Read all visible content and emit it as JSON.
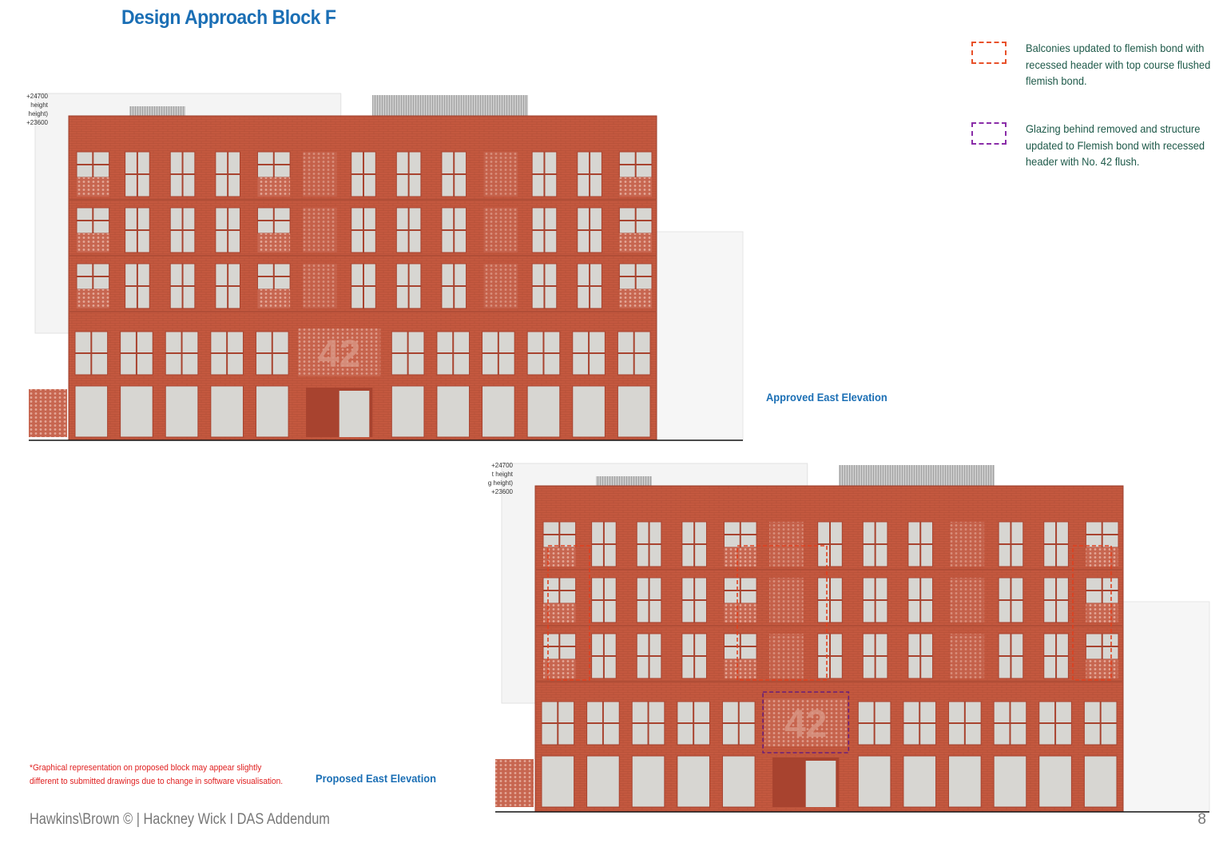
{
  "title": "Design Approach Block F",
  "legend": [
    {
      "text_lines": [
        "Balconies updated to flemish bond with",
        "recessed header with top course flushed",
        "flemish bond."
      ],
      "color": "#e8512a"
    },
    {
      "text_lines": [
        "Glazing behind removed and structure",
        "updated to Flemish bond with recessed",
        "header with No. 42 flush."
      ],
      "color": "#8a2da8"
    }
  ],
  "approved": {
    "caption": "Approved East Elevation",
    "level_labels": [
      "+24700",
      "height",
      "height)",
      "+23600"
    ],
    "building_number": "42"
  },
  "proposed": {
    "caption": "Proposed East Elevation",
    "level_labels": [
      "+24700",
      "t height",
      "g height)",
      "+23600"
    ],
    "building_number": "42"
  },
  "note_lines": [
    "*Graphical representation on proposed  block may appear slightly",
    "different to submitted drawings due to change in software visualisation."
  ],
  "footer": "Hawkins\\Brown © | Hackney Wick I DAS Addendum",
  "page_number": "8",
  "colors": {
    "brick": "#c4583f",
    "brick_dark": "#a8432f",
    "glass": "#d7d6d2",
    "accent_blue": "#1b6fb5",
    "legend_text": "#1f5a4a"
  }
}
